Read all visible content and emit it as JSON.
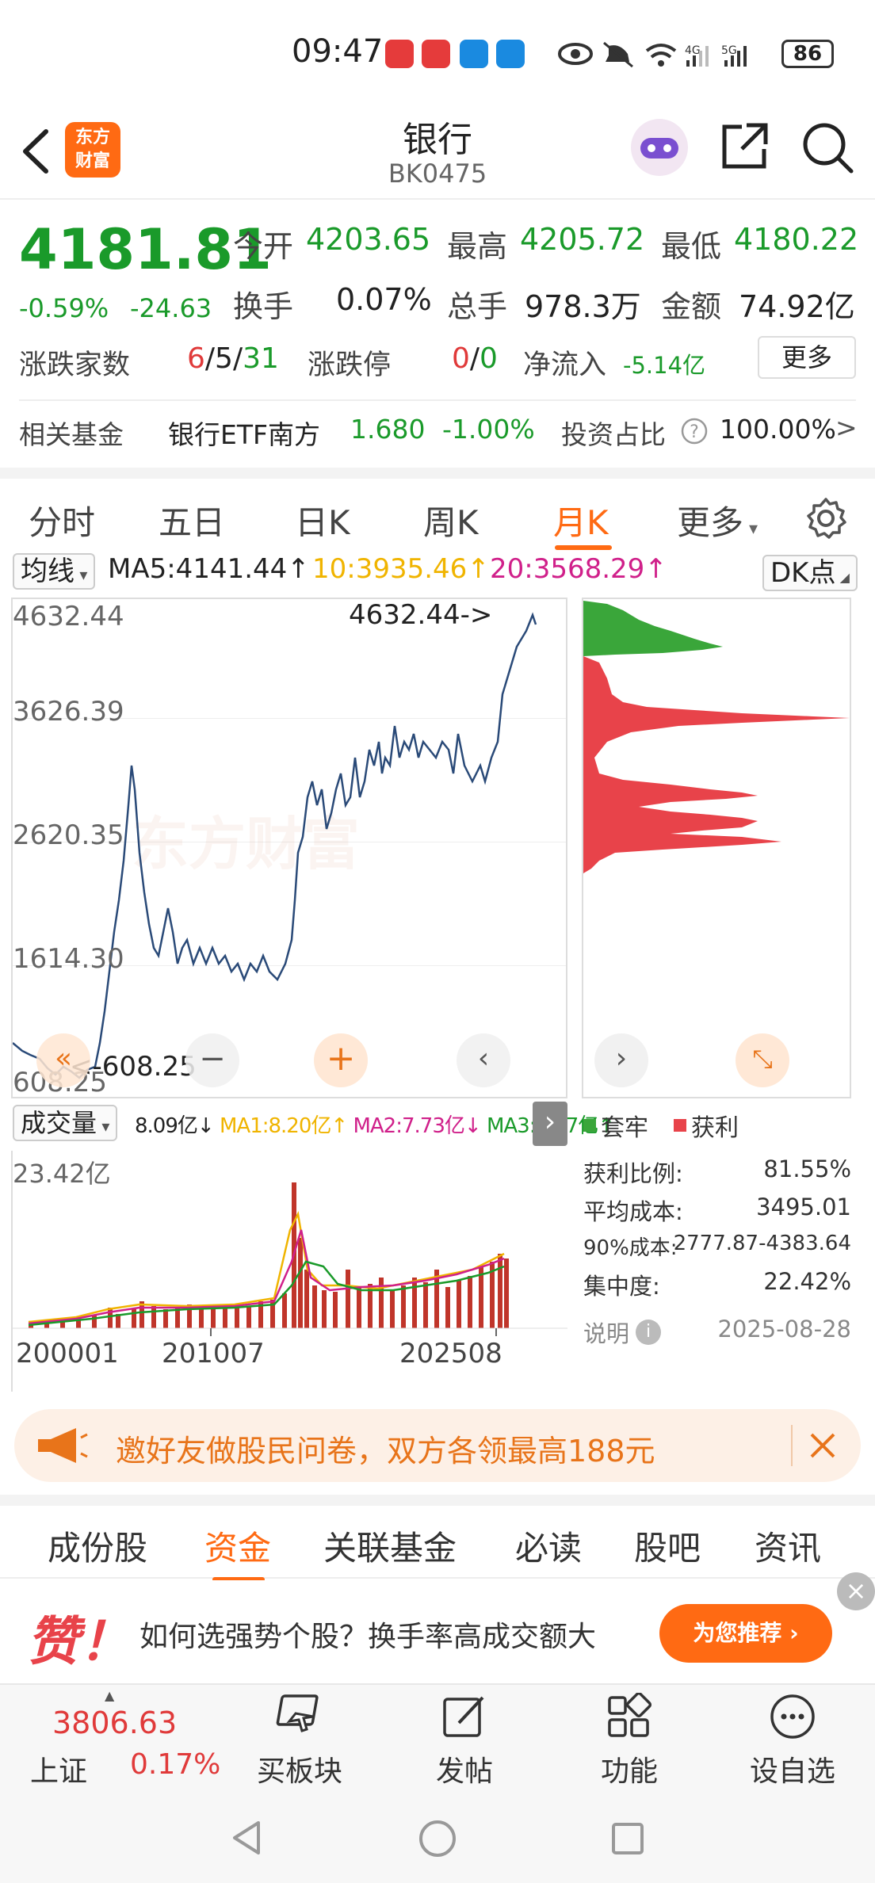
{
  "status": {
    "time": "09:47",
    "battery": "86"
  },
  "header": {
    "title": "银行",
    "code": "BK0475",
    "logo_line1": "东方",
    "logo_line2": "财富"
  },
  "quote": {
    "price": "4181.81",
    "change_pct": "-0.59%",
    "change": "-24.63",
    "open_label": "今开",
    "open": "4203.65",
    "high_label": "最高",
    "high": "4205.72",
    "low_label": "最低",
    "low": "4180.22",
    "turnover_label": "换手",
    "turnover": "0.07%",
    "volume_label": "总手",
    "volume": "978.3万",
    "amount_label": "金额",
    "amount": "74.92亿",
    "updown_label": "涨跌家数",
    "up": "6",
    "flat": "5",
    "down": "31",
    "limit_label": "涨跌停",
    "limit_up": "0",
    "limit_down": "0",
    "netflow_label": "净流入",
    "netflow": "-5.14亿",
    "more_button": "更多",
    "fund_label": "相关基金",
    "fund_name": "银行ETF南方",
    "fund_price": "1.680",
    "fund_change": "-1.00%",
    "invest_label": "投资占比",
    "invest_value": "100.00%"
  },
  "ktabs": [
    "分时",
    "五日",
    "日K",
    "周K",
    "月K",
    "更多"
  ],
  "ktabs_active": "月K",
  "chart": {
    "ma_dropdown": "均线",
    "ma5": "MA5:4141.44",
    "ma10": "10:3935.46",
    "ma20": "20:3568.29",
    "dk_dropdown": "DK点",
    "y_labels": [
      "4632.44",
      "3626.39",
      "2620.35",
      "1614.30",
      "608.25"
    ],
    "max_marker": "4632.44->",
    "min_marker": "<-608.25",
    "watermark": "东方财富",
    "vol_dropdown": "成交量",
    "vol_value": "8.09亿",
    "vol_ma1": "MA1:8.20亿",
    "vol_ma2": "MA2:7.73亿",
    "vol_ma3": "MA3:7.17亿",
    "vol_max": "23.42亿",
    "x_labels": [
      "200001",
      "201007",
      "202508"
    ],
    "ma_colors": {
      "ma5": "#222222",
      "ma10": "#f0b400",
      "ma20": "#d0208a"
    }
  },
  "chip": {
    "legend_trapped": "套牢",
    "legend_profit": "获利",
    "profit_ratio_label": "获利比例:",
    "profit_ratio": "81.55%",
    "avg_cost_label": "平均成本:",
    "avg_cost": "3495.01",
    "cost90_label": "90%成本:",
    "cost90": "2777.87-4383.64",
    "concentration_label": "集中度:",
    "concentration": "22.42%",
    "note_label": "说明",
    "date": "2025-08-28",
    "colors": {
      "trapped": "#3aa63a",
      "profit": "#e8434a"
    }
  },
  "banner": {
    "text": "邀好友做股民问卷，双方各领最高188元"
  },
  "ctabs": [
    "成份股",
    "资金",
    "关联基金",
    "必读",
    "股吧",
    "资讯"
  ],
  "ctabs_active": "资金",
  "ad": {
    "big_char": "赞！",
    "text": "如何选强势个股？换手率高成交额大",
    "button": "为您推荐"
  },
  "bottombar": {
    "index_value": "3806.63",
    "index_name": "上证",
    "index_change": "0.17%",
    "items": [
      "买板块",
      "发帖",
      "功能",
      "设自选"
    ]
  }
}
